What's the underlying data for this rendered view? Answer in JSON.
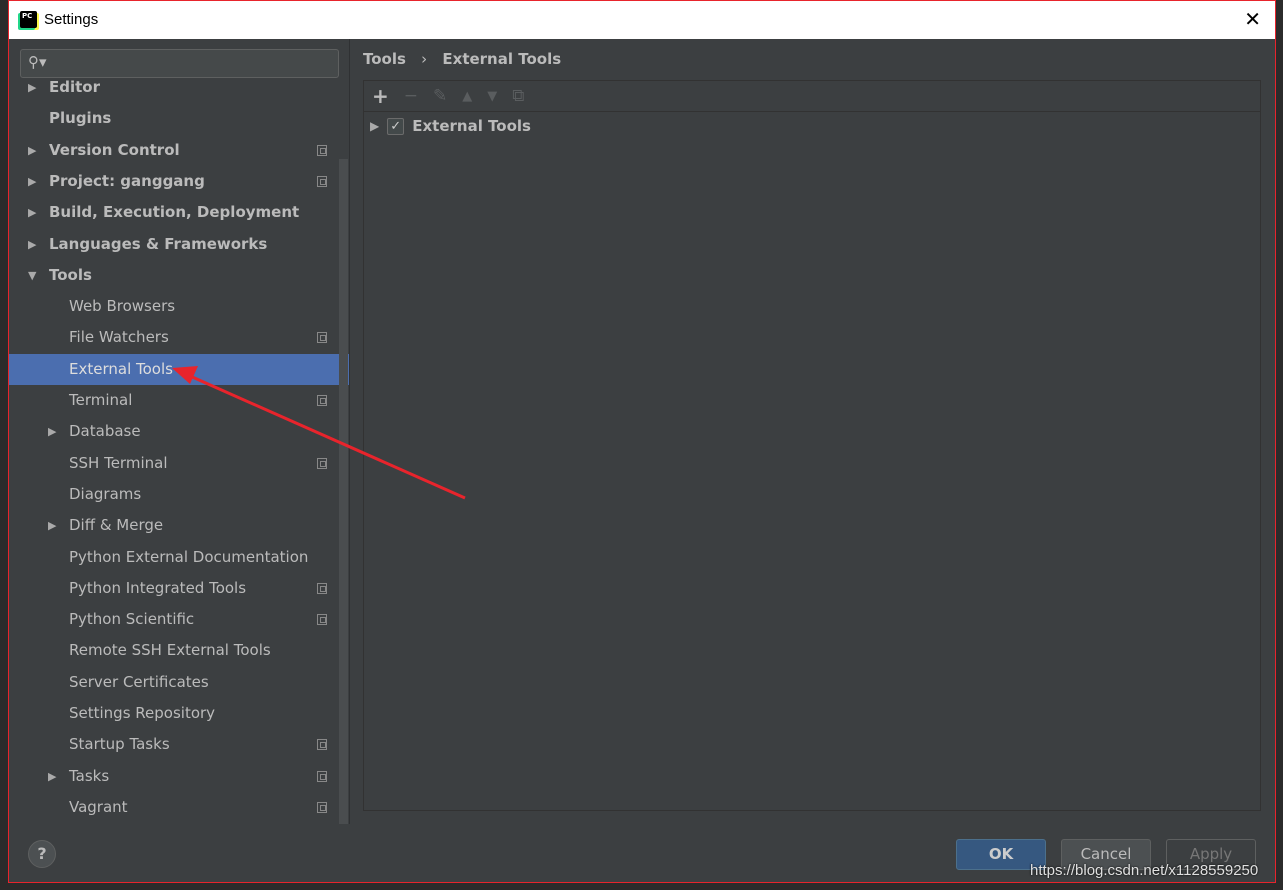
{
  "window": {
    "title": "Settings",
    "close": "✕"
  },
  "search": {
    "placeholder": "",
    "icon": "search-icon"
  },
  "sidebar": {
    "items": [
      {
        "label": "Editor",
        "level": 0,
        "bold": true,
        "arrow": "▶",
        "copy": false
      },
      {
        "label": "Plugins",
        "level": 0,
        "bold": true,
        "arrow": "",
        "copy": false
      },
      {
        "label": "Version Control",
        "level": 0,
        "bold": true,
        "arrow": "▶",
        "copy": true
      },
      {
        "label": "Project: ganggang",
        "level": 0,
        "bold": true,
        "arrow": "▶",
        "copy": true
      },
      {
        "label": "Build, Execution, Deployment",
        "level": 0,
        "bold": true,
        "arrow": "▶",
        "copy": false
      },
      {
        "label": "Languages & Frameworks",
        "level": 0,
        "bold": true,
        "arrow": "▶",
        "copy": false
      },
      {
        "label": "Tools",
        "level": 0,
        "bold": true,
        "arrow": "▼",
        "copy": false
      },
      {
        "label": "Web Browsers",
        "level": 1,
        "arrow": "",
        "copy": false
      },
      {
        "label": "File Watchers",
        "level": 1,
        "arrow": "",
        "copy": true
      },
      {
        "label": "External Tools",
        "level": 1,
        "arrow": "",
        "copy": false,
        "selected": true
      },
      {
        "label": "Terminal",
        "level": 1,
        "arrow": "",
        "copy": true
      },
      {
        "label": "Database",
        "level": 1,
        "arrow": "▶",
        "copy": false
      },
      {
        "label": "SSH Terminal",
        "level": 1,
        "arrow": "",
        "copy": true
      },
      {
        "label": "Diagrams",
        "level": 1,
        "arrow": "",
        "copy": false
      },
      {
        "label": "Diff & Merge",
        "level": 1,
        "arrow": "▶",
        "copy": false
      },
      {
        "label": "Python External Documentation",
        "level": 1,
        "arrow": "",
        "copy": false
      },
      {
        "label": "Python Integrated Tools",
        "level": 1,
        "arrow": "",
        "copy": true
      },
      {
        "label": "Python Scientific",
        "level": 1,
        "arrow": "",
        "copy": true
      },
      {
        "label": "Remote SSH External Tools",
        "level": 1,
        "arrow": "",
        "copy": false
      },
      {
        "label": "Server Certificates",
        "level": 1,
        "arrow": "",
        "copy": false
      },
      {
        "label": "Settings Repository",
        "level": 1,
        "arrow": "",
        "copy": false
      },
      {
        "label": "Startup Tasks",
        "level": 1,
        "arrow": "",
        "copy": true
      },
      {
        "label": "Tasks",
        "level": 1,
        "arrow": "▶",
        "copy": true
      },
      {
        "label": "Vagrant",
        "level": 1,
        "arrow": "",
        "copy": true
      }
    ]
  },
  "breadcrumb": {
    "parent": "Tools",
    "sep": "›",
    "current": "External Tools"
  },
  "toolbar": {
    "add": "+",
    "remove": "−",
    "edit": "✎",
    "up": "▲",
    "down": "▼",
    "copy": "⧉"
  },
  "tree": {
    "arrow": "▶",
    "checked": true,
    "check": "✓",
    "label": "External Tools"
  },
  "footer": {
    "help": "?",
    "ok": "OK",
    "cancel": "Cancel",
    "apply": "Apply"
  },
  "watermark": "https://blog.csdn.net/x1128559250",
  "colors": {
    "selection": "#4b6eaf",
    "annotation_arrow": "#e8242c"
  }
}
